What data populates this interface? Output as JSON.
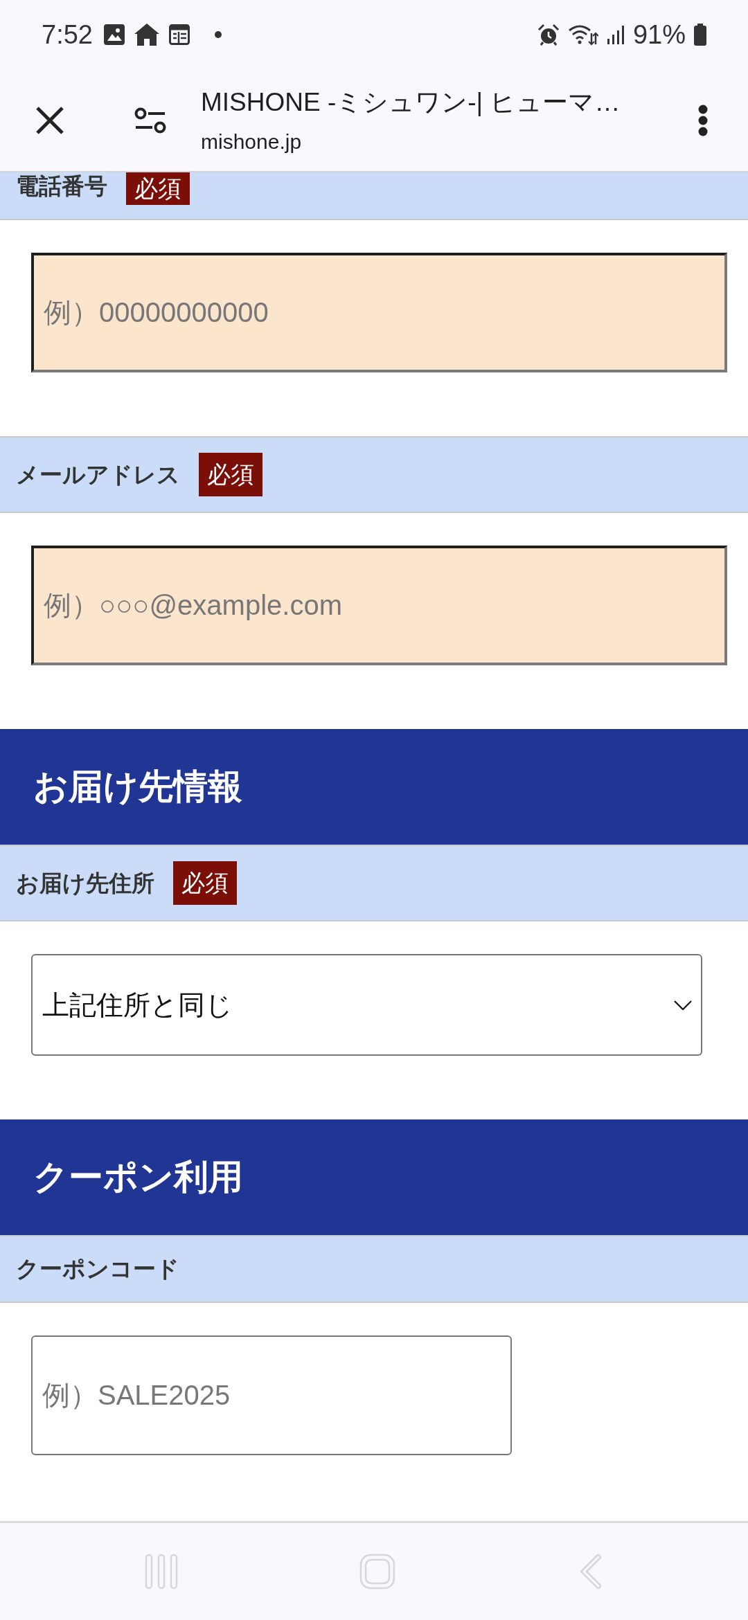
{
  "status_bar": {
    "time": "7:52",
    "battery": "91%"
  },
  "browser_bar": {
    "title": "MISHONE -ミシュワン-| ヒューマ…",
    "url": "mishone.jp"
  },
  "sections": [
    {
      "fields": [
        {
          "label": "電話番号",
          "badge": "必須",
          "kind": "input",
          "placeholder": "例）00000000000",
          "highlighted": true
        },
        {
          "label": "メールアドレス",
          "badge": "必須",
          "kind": "input",
          "placeholder": "例）○○○@example.com",
          "highlighted": true
        }
      ]
    },
    {
      "heading": "お届け先情報",
      "fields": [
        {
          "label": "お届け先住所",
          "badge": "必須",
          "kind": "select",
          "value": "上記住所と同じ"
        }
      ]
    },
    {
      "heading": "クーポン利用",
      "fields": [
        {
          "label": "クーポンコード",
          "kind": "input",
          "placeholder": "例）SALE2025",
          "highlighted": false
        }
      ]
    }
  ]
}
